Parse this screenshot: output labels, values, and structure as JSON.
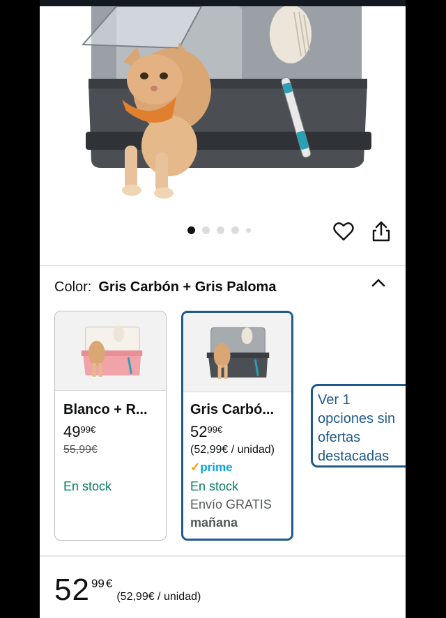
{
  "gallery": {
    "image_count": 5,
    "active_index": 0
  },
  "icons": {
    "favorite": "heart-icon",
    "share": "share-icon",
    "collapse": "chevron-up-icon"
  },
  "variant_selector": {
    "color_label": "Color:",
    "selected_color": "Gris Carbón + Gris Paloma",
    "options": [
      {
        "name": "Blanco + R...",
        "price_whole": "49",
        "price_fraction": "99",
        "currency": "€",
        "list_price": "55,99€",
        "stock": "En stock"
      },
      {
        "name": "Gris Carbó...",
        "price_whole": "52",
        "price_fraction": "99",
        "currency": "€",
        "unit_price": "(52,99€ / unidad)",
        "prime_check": "✓",
        "prime_label": "prime",
        "stock": "En stock",
        "shipping": "Envío GRATIS",
        "delivery": "mañana",
        "selected": true
      }
    ],
    "more_options": "Ver 1 opciones sin ofertas destacadas"
  },
  "buybox": {
    "price_whole": "52",
    "price_fraction": "99",
    "currency": "€",
    "unit_price": "(52,99€ / unidad)"
  },
  "colors": {
    "accent_blue": "#1f5a8c",
    "stock_green": "#067d62",
    "prime_blue": "#00a8e1",
    "top_bar": "#131921"
  }
}
